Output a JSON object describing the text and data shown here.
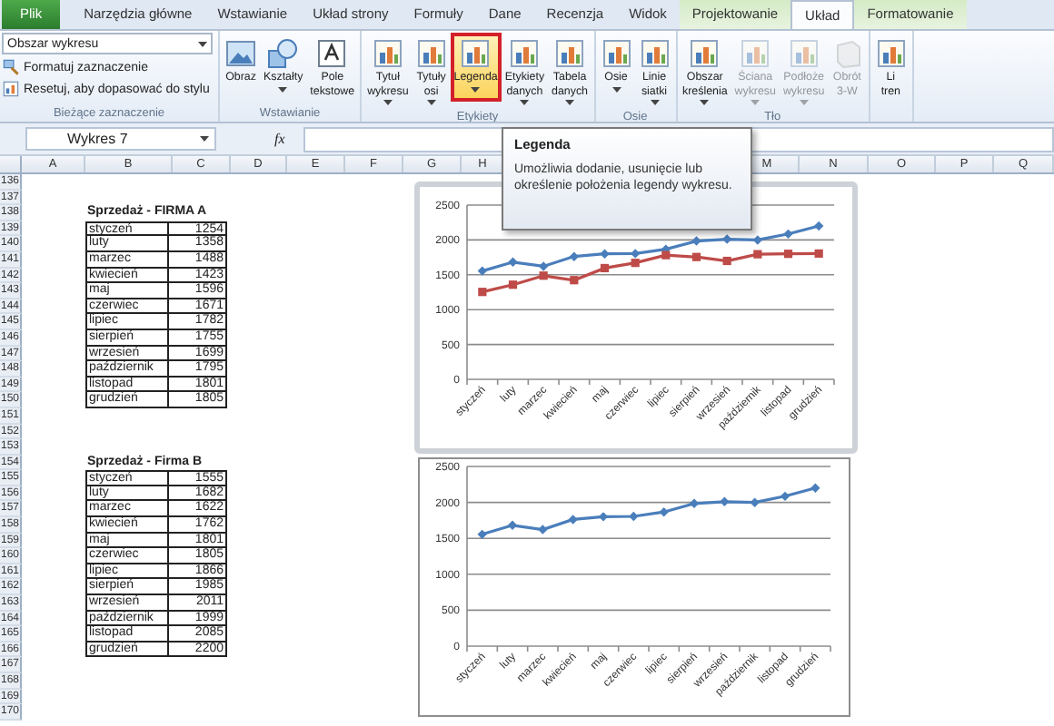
{
  "tabs": [
    {
      "label": "Plik",
      "kind": "file",
      "contextual": false,
      "selected": false
    },
    {
      "label": "Narzędzia główne",
      "kind": "tab",
      "contextual": false,
      "selected": false
    },
    {
      "label": "Wstawianie",
      "kind": "tab",
      "contextual": false,
      "selected": false
    },
    {
      "label": "Układ strony",
      "kind": "tab",
      "contextual": false,
      "selected": false
    },
    {
      "label": "Formuły",
      "kind": "tab",
      "contextual": false,
      "selected": false
    },
    {
      "label": "Dane",
      "kind": "tab",
      "contextual": false,
      "selected": false
    },
    {
      "label": "Recenzja",
      "kind": "tab",
      "contextual": false,
      "selected": false
    },
    {
      "label": "Widok",
      "kind": "tab",
      "contextual": false,
      "selected": false
    },
    {
      "label": "Projektowanie",
      "kind": "tab",
      "contextual": true,
      "selected": false
    },
    {
      "label": "Układ",
      "kind": "tab",
      "contextual": true,
      "selected": true
    },
    {
      "label": "Formatowanie",
      "kind": "tab",
      "contextual": true,
      "selected": false
    }
  ],
  "ribbon": {
    "groups": [
      {
        "label": "Bieżące zaznaczenie",
        "kind": "selection",
        "dropdown": "Obszar wykresu",
        "commands": [
          "Formatuj zaznaczenie",
          "Resetuj, aby dopasować do stylu"
        ]
      },
      {
        "label": "Wstawianie",
        "kind": "buttons",
        "buttons": [
          {
            "label": "Obraz",
            "dropdown": false,
            "highlighted": false,
            "disabled": false
          },
          {
            "label": "Kształty",
            "dropdown": true,
            "highlighted": false,
            "disabled": false
          },
          {
            "label": "Pole tekstowe",
            "dropdown": false,
            "highlighted": false,
            "disabled": false
          }
        ]
      },
      {
        "label": "Etykiety",
        "kind": "buttons",
        "buttons": [
          {
            "label": "Tytuł wykresu",
            "dropdown": true,
            "highlighted": false,
            "disabled": false
          },
          {
            "label": "Tytuły osi",
            "dropdown": true,
            "highlighted": false,
            "disabled": false
          },
          {
            "label": "Legenda",
            "dropdown": true,
            "highlighted": true,
            "disabled": false
          },
          {
            "label": "Etykiety danych",
            "dropdown": true,
            "highlighted": false,
            "disabled": false
          },
          {
            "label": "Tabela danych",
            "dropdown": true,
            "highlighted": false,
            "disabled": false
          }
        ]
      },
      {
        "label": "Osie",
        "kind": "buttons",
        "buttons": [
          {
            "label": "Osie",
            "dropdown": true,
            "highlighted": false,
            "disabled": false
          },
          {
            "label": "Linie siatki",
            "dropdown": true,
            "highlighted": false,
            "disabled": false
          }
        ]
      },
      {
        "label": "Tło",
        "kind": "buttons",
        "buttons": [
          {
            "label": "Obszar kreślenia",
            "dropdown": true,
            "highlighted": false,
            "disabled": false
          },
          {
            "label": "Ściana wykresu",
            "dropdown": true,
            "highlighted": false,
            "disabled": true
          },
          {
            "label": "Podłoże wykresu",
            "dropdown": true,
            "highlighted": false,
            "disabled": true
          },
          {
            "label": "Obrót 3-W",
            "dropdown": false,
            "highlighted": false,
            "disabled": true
          }
        ]
      },
      {
        "kind": "buttons",
        "buttons": [
          {
            "label": "Li tren",
            "dropdown": false,
            "highlighted": false,
            "disabled": false
          }
        ]
      }
    ]
  },
  "formula_bar": {
    "name_box": "Wykres 7",
    "function_button": "fx"
  },
  "tooltip": {
    "title": "Legenda",
    "text": "Umożliwia dodanie, usunięcie lub określenie położenia legendy wykresu."
  },
  "sheet": {
    "column_headers": [
      "A",
      "B",
      "C",
      "D",
      "E",
      "F",
      "G",
      "H",
      "M",
      "N",
      "O",
      "P",
      "Q"
    ],
    "row_numbers": [
      "136",
      "137",
      "138",
      "139",
      "140",
      "141",
      "142",
      "143",
      "144",
      "145",
      "146",
      "147",
      "148",
      "149",
      "150",
      "151",
      "152",
      "153",
      "154",
      "155",
      "156",
      "157",
      "158",
      "159",
      "160",
      "161",
      "162",
      "163",
      "164",
      "165",
      "166",
      "167",
      "168",
      "169",
      "170"
    ],
    "tables": [
      {
        "title": "Sprzedaż - FIRMA A",
        "rows": [
          {
            "month": "styczeń",
            "value": "1254"
          },
          {
            "month": "luty",
            "value": "1358"
          },
          {
            "month": "marzec",
            "value": "1488"
          },
          {
            "month": "kwiecień",
            "value": "1423"
          },
          {
            "month": "maj",
            "value": "1596"
          },
          {
            "month": "czerwiec",
            "value": "1671"
          },
          {
            "month": "lipiec",
            "value": "1782"
          },
          {
            "month": "sierpień",
            "value": "1755"
          },
          {
            "month": "wrzesień",
            "value": "1699"
          },
          {
            "month": "październik",
            "value": "1795"
          },
          {
            "month": "listopad",
            "value": "1801"
          },
          {
            "month": "grudzień",
            "value": "1805"
          }
        ]
      },
      {
        "title": "Sprzedaż - Firma B",
        "rows": [
          {
            "month": "styczeń",
            "value": "1555"
          },
          {
            "month": "luty",
            "value": "1682"
          },
          {
            "month": "marzec",
            "value": "1622"
          },
          {
            "month": "kwiecień",
            "value": "1762"
          },
          {
            "month": "maj",
            "value": "1801"
          },
          {
            "month": "czerwiec",
            "value": "1805"
          },
          {
            "month": "lipiec",
            "value": "1866"
          },
          {
            "month": "sierpień",
            "value": "1985"
          },
          {
            "month": "wrzesień",
            "value": "2011"
          },
          {
            "month": "październik",
            "value": "1999"
          },
          {
            "month": "listopad",
            "value": "2085"
          },
          {
            "month": "grudzień",
            "value": "2200"
          }
        ]
      }
    ]
  },
  "charts": [
    {
      "selected": true,
      "chart_data": {
        "type": "line",
        "grid": true,
        "categories": [
          "styczeń",
          "luty",
          "marzec",
          "kwiecień",
          "maj",
          "czerwiec",
          "lipiec",
          "sierpień",
          "wrzesień",
          "październik",
          "listopad",
          "grudzień"
        ],
        "ylim": [
          0,
          2500
        ],
        "yticks": [
          0,
          500,
          1000,
          1500,
          2000,
          2500
        ],
        "series": [
          {
            "color": "#4a7ebb",
            "marker": "diamond",
            "values": [
              1555,
              1682,
              1622,
              1762,
              1801,
              1805,
              1866,
              1985,
              2011,
              1999,
              2085,
              2200
            ]
          },
          {
            "color": "#be4b48",
            "marker": "square",
            "values": [
              1254,
              1358,
              1488,
              1423,
              1596,
              1671,
              1782,
              1755,
              1699,
              1795,
              1801,
              1805
            ]
          }
        ]
      }
    },
    {
      "selected": false,
      "chart_data": {
        "type": "line",
        "grid": true,
        "categories": [
          "styczeń",
          "luty",
          "marzec",
          "kwiecień",
          "maj",
          "czerwiec",
          "lipiec",
          "sierpień",
          "wrzesień",
          "październik",
          "listopad",
          "grudzień"
        ],
        "ylim": [
          0,
          2500
        ],
        "yticks": [
          0,
          500,
          1000,
          1500,
          2000,
          2500
        ],
        "series": [
          {
            "color": "#4a7ebb",
            "marker": "diamond",
            "values": [
              1555,
              1682,
              1622,
              1762,
              1801,
              1805,
              1866,
              1985,
              2011,
              1999,
              2085,
              2200
            ]
          }
        ]
      }
    }
  ]
}
